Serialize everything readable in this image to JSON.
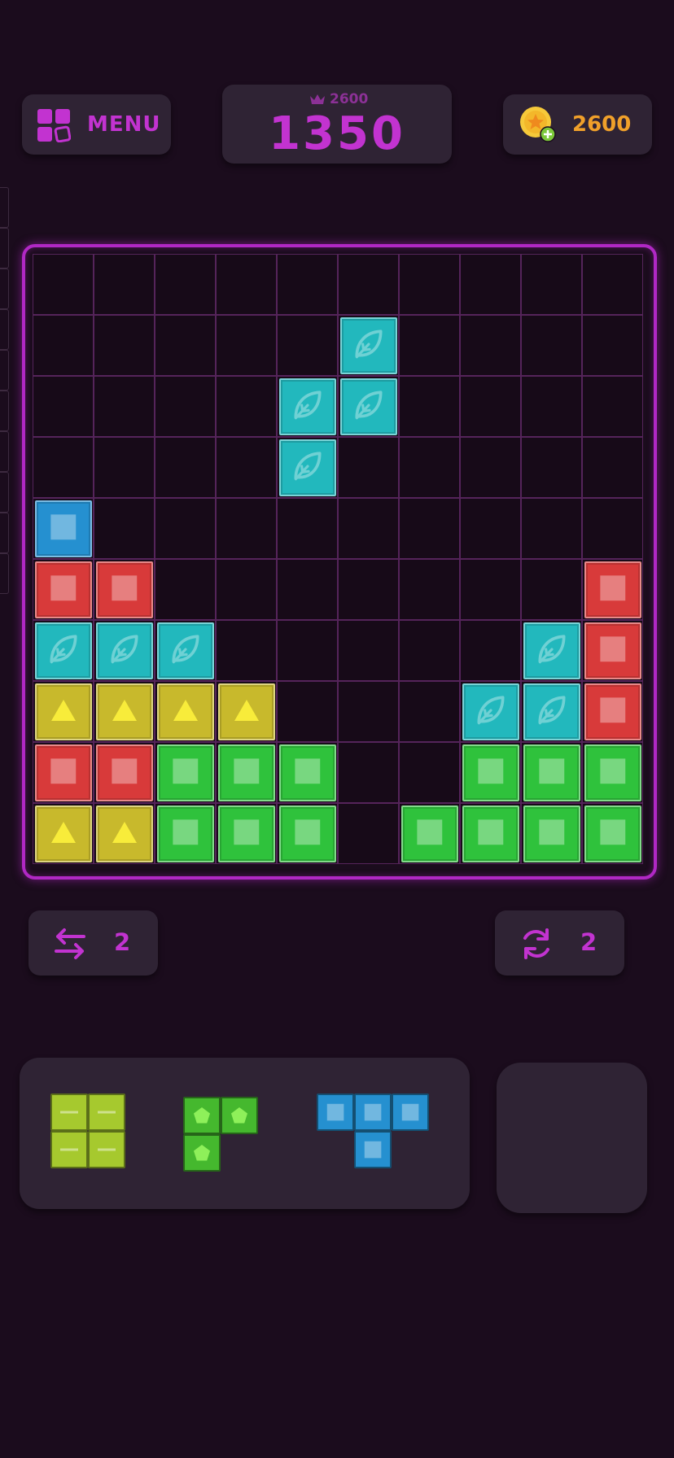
{
  "header": {
    "menu_label": "MENU",
    "best_score": "2600",
    "current_score": "1350",
    "coins": "2600"
  },
  "board": {
    "rows": 10,
    "cols": 10,
    "blocks": [
      {
        "r": 1,
        "c": 5,
        "color": "cyan",
        "icon": "leaf"
      },
      {
        "r": 2,
        "c": 4,
        "color": "cyan",
        "icon": "leaf"
      },
      {
        "r": 2,
        "c": 5,
        "color": "cyan",
        "icon": "leaf"
      },
      {
        "r": 3,
        "c": 4,
        "color": "cyan",
        "icon": "leaf"
      },
      {
        "r": 4,
        "c": 0,
        "color": "blue",
        "icon": "square"
      },
      {
        "r": 5,
        "c": 0,
        "color": "red",
        "icon": "square"
      },
      {
        "r": 5,
        "c": 1,
        "color": "red",
        "icon": "square"
      },
      {
        "r": 5,
        "c": 9,
        "color": "red",
        "icon": "square"
      },
      {
        "r": 6,
        "c": 0,
        "color": "cyan",
        "icon": "leaf"
      },
      {
        "r": 6,
        "c": 1,
        "color": "cyan",
        "icon": "leaf"
      },
      {
        "r": 6,
        "c": 2,
        "color": "cyan",
        "icon": "leaf"
      },
      {
        "r": 6,
        "c": 8,
        "color": "cyan",
        "icon": "leaf"
      },
      {
        "r": 6,
        "c": 9,
        "color": "red",
        "icon": "square"
      },
      {
        "r": 7,
        "c": 0,
        "color": "yellow",
        "icon": "triangle"
      },
      {
        "r": 7,
        "c": 1,
        "color": "yellow",
        "icon": "triangle"
      },
      {
        "r": 7,
        "c": 2,
        "color": "yellow",
        "icon": "triangle"
      },
      {
        "r": 7,
        "c": 3,
        "color": "yellow",
        "icon": "triangle"
      },
      {
        "r": 7,
        "c": 7,
        "color": "cyan",
        "icon": "leaf"
      },
      {
        "r": 7,
        "c": 8,
        "color": "cyan",
        "icon": "leaf"
      },
      {
        "r": 7,
        "c": 9,
        "color": "red",
        "icon": "square"
      },
      {
        "r": 8,
        "c": 0,
        "color": "red",
        "icon": "square"
      },
      {
        "r": 8,
        "c": 1,
        "color": "red",
        "icon": "square"
      },
      {
        "r": 8,
        "c": 2,
        "color": "green",
        "icon": "square"
      },
      {
        "r": 8,
        "c": 3,
        "color": "green",
        "icon": "square"
      },
      {
        "r": 8,
        "c": 4,
        "color": "green",
        "icon": "square"
      },
      {
        "r": 8,
        "c": 7,
        "color": "green",
        "icon": "square"
      },
      {
        "r": 8,
        "c": 8,
        "color": "green",
        "icon": "square"
      },
      {
        "r": 8,
        "c": 9,
        "color": "green",
        "icon": "square"
      },
      {
        "r": 9,
        "c": 0,
        "color": "yellow",
        "icon": "triangle"
      },
      {
        "r": 9,
        "c": 1,
        "color": "yellow",
        "icon": "triangle"
      },
      {
        "r": 9,
        "c": 2,
        "color": "green",
        "icon": "square"
      },
      {
        "r": 9,
        "c": 3,
        "color": "green",
        "icon": "square"
      },
      {
        "r": 9,
        "c": 4,
        "color": "green",
        "icon": "square"
      },
      {
        "r": 9,
        "c": 6,
        "color": "green",
        "icon": "square"
      },
      {
        "r": 9,
        "c": 7,
        "color": "green",
        "icon": "square"
      },
      {
        "r": 9,
        "c": 8,
        "color": "green",
        "icon": "square"
      },
      {
        "r": 9,
        "c": 9,
        "color": "green",
        "icon": "square"
      }
    ]
  },
  "powerups": {
    "swap_count": "2",
    "rotate_count": "2"
  },
  "tray_pieces": [
    {
      "name": "lime-square-piece",
      "color": "lime",
      "icon": "dash",
      "cells": [
        [
          0,
          0
        ],
        [
          0,
          1
        ],
        [
          1,
          0
        ],
        [
          1,
          1
        ]
      ]
    },
    {
      "name": "green-l-piece",
      "color": "leafgreen",
      "icon": "pentagon",
      "cells": [
        [
          0,
          0
        ],
        [
          0,
          1
        ],
        [
          1,
          0
        ]
      ]
    },
    {
      "name": "blue-t-piece",
      "color": "blue",
      "icon": "square",
      "cells": [
        [
          0,
          0
        ],
        [
          0,
          1
        ],
        [
          0,
          2
        ],
        [
          1,
          1
        ]
      ]
    }
  ],
  "colors": {
    "accent": "#c233d0",
    "coin": "#f0a02a",
    "red": "#d83a3a",
    "cyan": "#22b8bd",
    "yellow": "#c8b92c",
    "green": "#2fc23c",
    "blue": "#2590d0",
    "lime": "#a6c92e",
    "leafgreen": "#45b82e"
  }
}
